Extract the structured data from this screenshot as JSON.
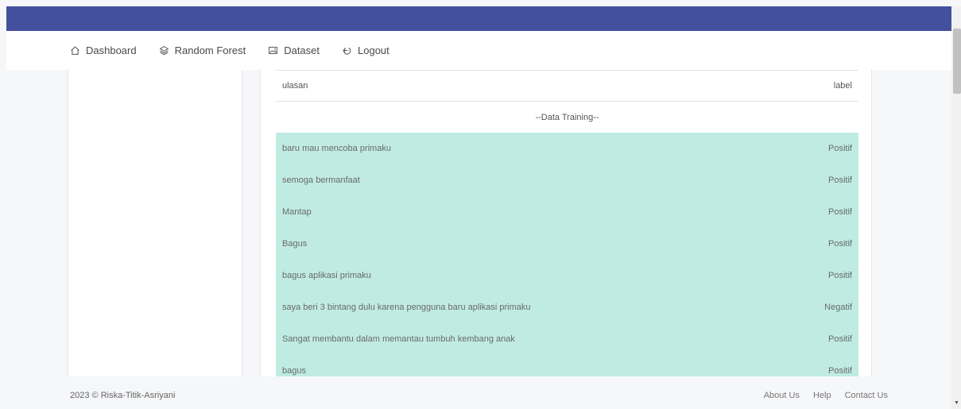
{
  "nav": {
    "items": [
      {
        "label": "Dashboard",
        "icon": "home-icon"
      },
      {
        "label": "Random Forest",
        "icon": "layers-icon"
      },
      {
        "label": "Dataset",
        "icon": "image-icon"
      },
      {
        "label": "Logout",
        "icon": "logout-icon"
      }
    ]
  },
  "table": {
    "headers": {
      "review": "ulasan",
      "label": "label"
    },
    "group_label": "--Data Training--",
    "rows": [
      {
        "text": "baru mau mencoba primaku",
        "label": "Positif"
      },
      {
        "text": "semoga bermanfaat",
        "label": "Positif"
      },
      {
        "text": "Mantap",
        "label": "Positif"
      },
      {
        "text": "Bagus",
        "label": "Positif"
      },
      {
        "text": "bagus aplikasi primaku",
        "label": "Positif"
      },
      {
        "text": "saya beri 3 bintang dulu karena pengguna baru aplikasi primaku",
        "label": "Negatif"
      },
      {
        "text": "Sangat membantu dalam memantau tumbuh kembang anak",
        "label": "Positif"
      },
      {
        "text": "bagus",
        "label": "Positif"
      }
    ]
  },
  "footer": {
    "copyright": "2023 © Riska-Titik-Asriyani",
    "links": [
      "About Us",
      "Help",
      "Contact Us"
    ]
  },
  "colors": {
    "topbar": "#43509e",
    "row_highlight": "#bfebe2"
  }
}
